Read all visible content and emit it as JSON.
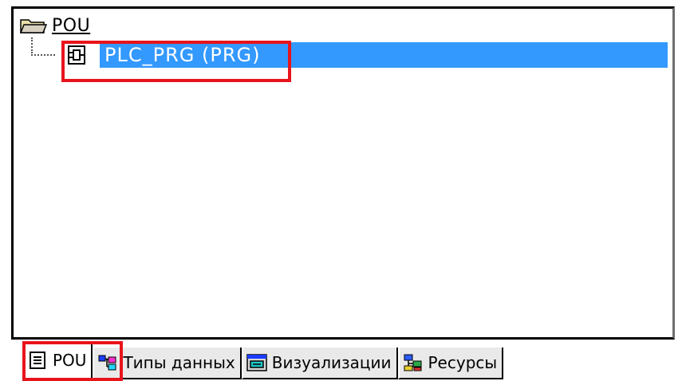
{
  "tree": {
    "root_label": "POU",
    "items": [
      {
        "label": "PLC_PRG (PRG)",
        "selected": true
      }
    ]
  },
  "tabs": [
    {
      "label": "POU",
      "active": true,
      "icon": "document-icon"
    },
    {
      "label": "Типы данных",
      "active": false,
      "icon": "datatypes-icon"
    },
    {
      "label": "Визуализации",
      "active": false,
      "icon": "visualization-icon"
    },
    {
      "label": "Ресурсы",
      "active": false,
      "icon": "resources-icon"
    }
  ],
  "colors": {
    "selection": "#3399ff",
    "highlight_box": "#e8141c"
  }
}
